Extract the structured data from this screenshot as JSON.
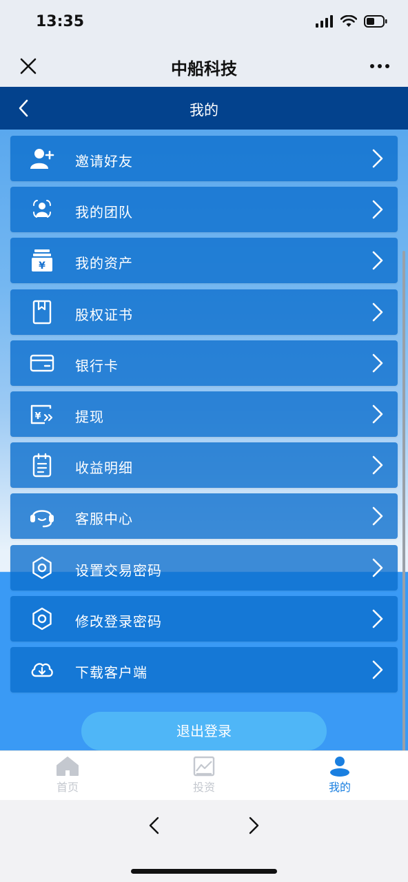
{
  "status": {
    "time": "13:35"
  },
  "wechat": {
    "title": "中船科技"
  },
  "header": {
    "title": "我的"
  },
  "menu": [
    {
      "label": "邀请好友",
      "icon": "add-user-icon"
    },
    {
      "label": "我的团队",
      "icon": "team-icon"
    },
    {
      "label": "我的资产",
      "icon": "assets-icon"
    },
    {
      "label": "股权证书",
      "icon": "certificate-icon"
    },
    {
      "label": "银行卡",
      "icon": "bank-card-icon"
    },
    {
      "label": "提现",
      "icon": "withdraw-icon"
    },
    {
      "label": "收益明细",
      "icon": "clipboard-icon"
    },
    {
      "label": "客服中心",
      "icon": "headset-icon"
    },
    {
      "label": "设置交易密码",
      "icon": "gear-icon"
    },
    {
      "label": "修改登录密码",
      "icon": "gear-icon"
    },
    {
      "label": "下载客户端",
      "icon": "cloud-download-icon"
    }
  ],
  "logout": {
    "label": "退出登录"
  },
  "tabs": [
    {
      "label": "首页",
      "icon": "home-icon",
      "active": false
    },
    {
      "label": "投资",
      "icon": "chart-icon",
      "active": false
    },
    {
      "label": "我的",
      "icon": "user-icon",
      "active": true
    }
  ],
  "colors": {
    "header": "#03428d",
    "accent": "#1a7fe0",
    "item": "#1a73d0",
    "logout": "#4fb6f7"
  }
}
